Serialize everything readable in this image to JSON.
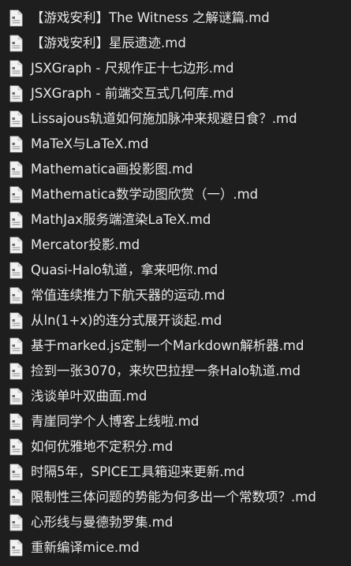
{
  "file_icon": "markdown-file-icon",
  "files": [
    "【游戏安利】The Witness 之解谜篇.md",
    "【游戏安利】星辰遗迹.md",
    "JSXGraph - 尺规作正十七边形.md",
    "JSXGraph - 前端交互式几何库.md",
    "Lissajous轨道如何施加脉冲来规避日食？.md",
    "MaTeX与LaTeX.md",
    "Mathematica画投影图.md",
    "Mathematica数学动图欣赏（一）.md",
    "MathJax服务端渲染LaTeX.md",
    "Mercator投影.md",
    "Quasi-Halo轨道，拿来吧你.md",
    "常值连续推力下航天器的运动.md",
    "从ln(1+x)的连分式展开谈起.md",
    "基于marked.js定制一个Markdown解析器.md",
    "捡到一张3070，来坎巴拉捏一条Halo轨道.md",
    "浅谈单叶双曲面.md",
    "青崖同学个人博客上线啦.md",
    "如何优雅地不定积分.md",
    "时隔5年，SPICE工具箱迎来更新.md",
    "限制性三体问题的势能为何多出一个常数项？.md",
    "心形线与曼德勃罗集.md",
    "重新编译mice.md"
  ]
}
